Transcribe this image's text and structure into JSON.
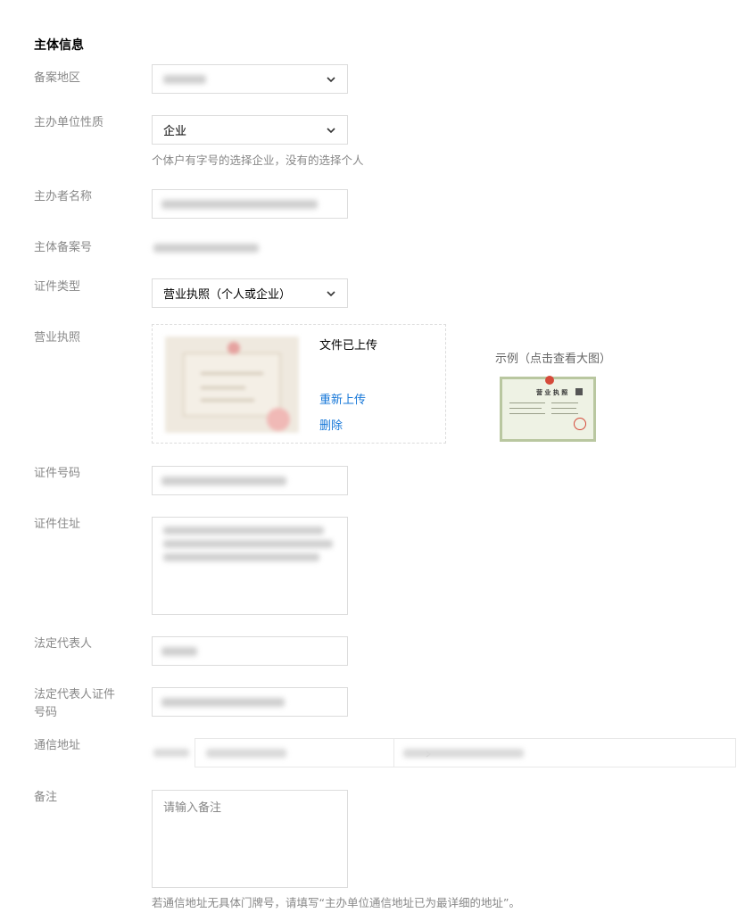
{
  "section_title": "主体信息",
  "fields": {
    "region": {
      "label": "备案地区"
    },
    "org_type": {
      "label": "主办单位性质",
      "value": "企业",
      "hint": "个体户有字号的选择企业，没有的选择个人"
    },
    "sponsor_name": {
      "label": "主办者名称"
    },
    "record_number": {
      "label": "主体备案号"
    },
    "cert_type": {
      "label": "证件类型",
      "value": "营业执照（个人或企业）"
    },
    "license": {
      "label": "营业执照",
      "status": "文件已上传",
      "reupload": "重新上传",
      "delete": "删除",
      "example_label": "示例（点击查看大图）",
      "example_title": "营 业 执 照"
    },
    "cert_number": {
      "label": "证件号码"
    },
    "cert_address": {
      "label": "证件住址"
    },
    "legal_rep": {
      "label": "法定代表人"
    },
    "legal_rep_id": {
      "label": "法定代表人证件号码"
    },
    "mail_address": {
      "label": "通信地址"
    },
    "remark": {
      "label": "备注",
      "placeholder": "请输入备注",
      "hint": "若通信地址无具体门牌号，请填写“主办单位通信地址已为最详细的地址”。"
    }
  },
  "colors": {
    "link": "#1677d8",
    "label": "#888888",
    "border": "#dcdcdc"
  },
  "icons": {
    "dropdown": "chevron-down-icon",
    "separator": "chevron-right-icon"
  }
}
